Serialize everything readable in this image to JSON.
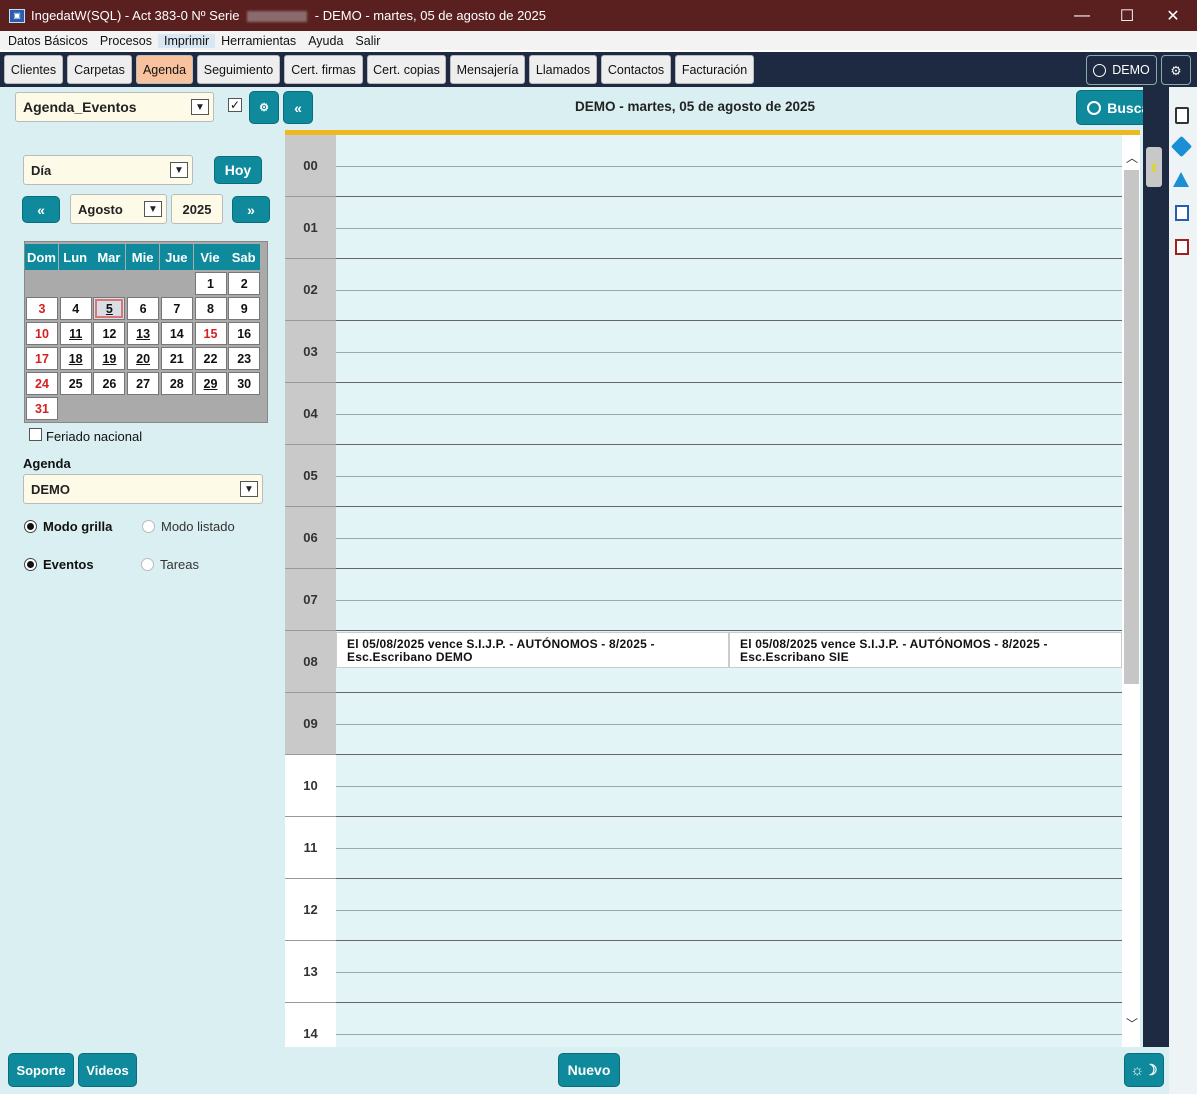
{
  "window": {
    "title_prefix": "IngedatW(SQL) - Act 383-0 Nº Serie",
    "title_suffix": "- DEMO - martes, 05 de agosto de 2025",
    "minimize": "—",
    "maximize": "☐",
    "close": "✕"
  },
  "menu": [
    "Datos Básicos",
    "Procesos",
    "Imprimir",
    "Herramientas",
    "Ayuda",
    "Salir"
  ],
  "tabs": [
    "Clientes",
    "Carpetas",
    "Agenda",
    "Seguimiento",
    "Cert. firmas",
    "Cert. copias",
    "Mensajería",
    "Llamados",
    "Contactos",
    "Facturación"
  ],
  "user_button": "DEMO",
  "filter": {
    "view_select": "Agenda_Eventos",
    "header_date": "DEMO - martes, 05 de agosto de 2025",
    "search_label": "Buscar",
    "collapse_label": "«"
  },
  "sidebar": {
    "period_select": "Día",
    "today_button": "Hoy",
    "prev": "«",
    "next": "»",
    "month_select": "Agosto",
    "year": "2025",
    "weekdays": [
      "Dom",
      "Lun",
      "Mar",
      "Mie",
      "Jue",
      "Vie",
      "Sab"
    ],
    "holiday_label": "Feriado nacional",
    "agenda_heading": "Agenda",
    "agenda_select": "DEMO",
    "grid_mode": "Modo grilla",
    "list_mode": "Modo listado",
    "events": "Eventos",
    "tasks": "Tareas"
  },
  "calendar": {
    "weeks": [
      [
        "",
        "",
        "",
        "",
        "",
        "1",
        "2"
      ],
      [
        "3",
        "4",
        "5",
        "6",
        "7",
        "8",
        "9"
      ],
      [
        "10",
        "11",
        "12",
        "13",
        "14",
        "15",
        "16"
      ],
      [
        "17",
        "18",
        "19",
        "20",
        "21",
        "22",
        "23"
      ],
      [
        "24",
        "25",
        "26",
        "27",
        "28",
        "29",
        "30"
      ],
      [
        "31",
        "",
        "",
        "",
        "",
        "",
        ""
      ]
    ],
    "red_days": [
      "3",
      "10",
      "15",
      "17",
      "24",
      "31"
    ],
    "underlined_days": [
      "5",
      "11",
      "13",
      "18",
      "19",
      "20",
      "29"
    ],
    "selected_day": "5"
  },
  "hours": [
    "00",
    "01",
    "02",
    "03",
    "04",
    "05",
    "06",
    "07",
    "08",
    "09",
    "10",
    "11",
    "12",
    "13",
    "14"
  ],
  "events": [
    {
      "line1": "El 05/08/2025 vence S.I.J.P. - AUTÓNOMOS - 8/2025 -",
      "line2": "Esc.Escribano DEMO"
    },
    {
      "line1": "El 05/08/2025 vence S.I.J.P. - AUTÓNOMOS - 8/2025 -",
      "line2": "Esc.Escribano SIE"
    }
  ],
  "bottom": {
    "support": "Soporte",
    "videos": "Videos",
    "new": "Nuevo"
  },
  "colors": {
    "titlebar": "#5a2020",
    "toolbar": "#1e2a42",
    "teal": "#0e8a9c",
    "panel": "#d9eff1",
    "active_tab": "#f7c29d",
    "gold": "#f0b820"
  }
}
